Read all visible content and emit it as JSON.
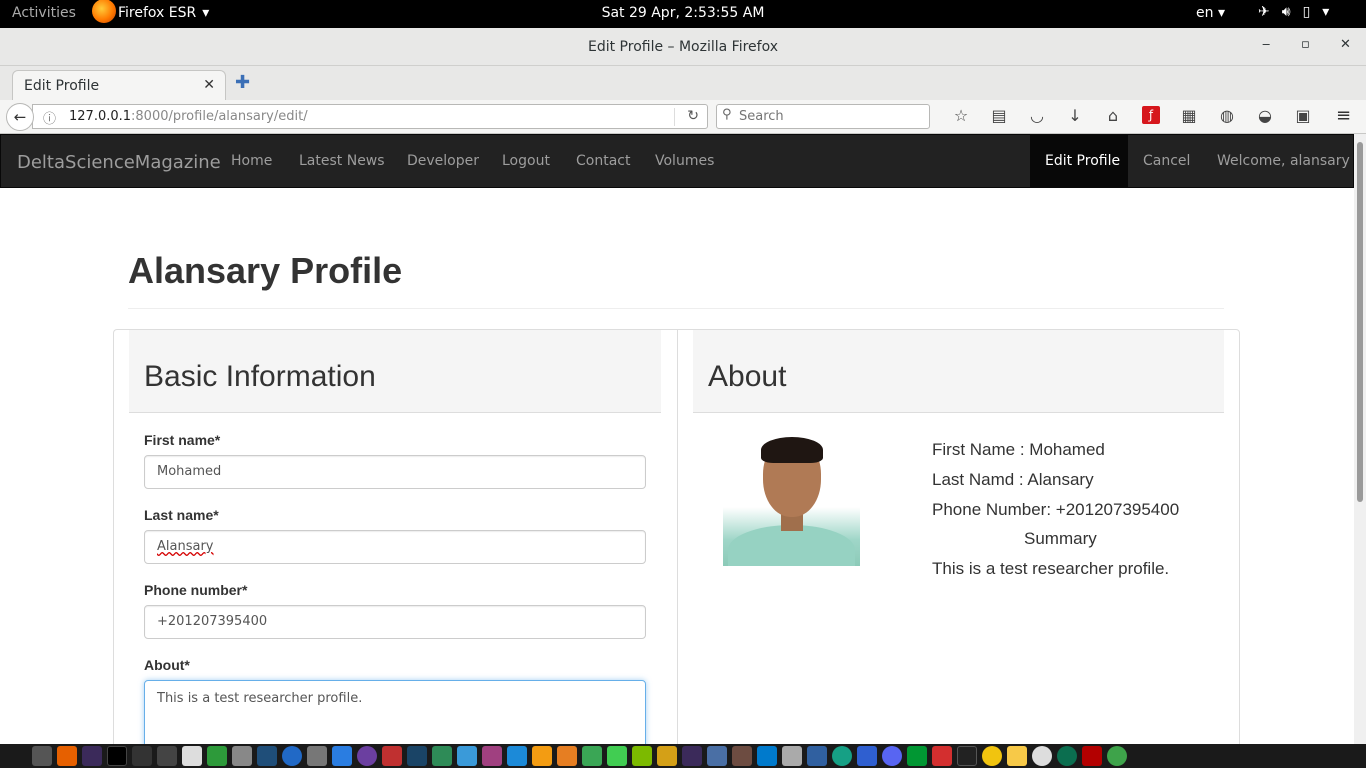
{
  "topbar": {
    "activities": "Activities",
    "app_name": "Firefox ESR",
    "clock": "Sat 29 Apr,  2:53:55 AM",
    "lang": "en"
  },
  "window": {
    "title": "Edit Profile – Mozilla Firefox"
  },
  "browser": {
    "tab_title": "Edit Profile",
    "url_host": "127.0.0.1",
    "url_rest": ":8000/profile/alansary/edit/",
    "search_placeholder": "Search"
  },
  "site": {
    "brand": "DeltaScienceMagazine",
    "nav": [
      "Home",
      "Latest News",
      "Developer",
      "Logout",
      "Contact",
      "Volumes"
    ],
    "nav_right": {
      "edit_profile": "Edit Profile",
      "cancel": "Cancel",
      "welcome": "Welcome, alansary"
    }
  },
  "page": {
    "title": "Alansary Profile"
  },
  "basic_info": {
    "heading": "Basic Information",
    "first_name_label": "First name*",
    "first_name_value": "Mohamed",
    "last_name_label": "Last name*",
    "last_name_value": "Alansary",
    "phone_label": "Phone number*",
    "phone_value": "+201207395400",
    "about_label": "About*",
    "about_value": "This is a test researcher profile."
  },
  "about_panel": {
    "heading": "About",
    "first_name": "First Name : Mohamed",
    "last_name": "Last Namd : Alansary",
    "phone": "Phone Number: +201207395400",
    "summary_heading": "Summary",
    "summary": "This is a test researcher profile."
  },
  "colors": {
    "navbar_bg": "#222222",
    "nav_active_bg": "#080808",
    "panel_head_bg": "#f5f5f5",
    "focus_border": "#66afe9"
  }
}
